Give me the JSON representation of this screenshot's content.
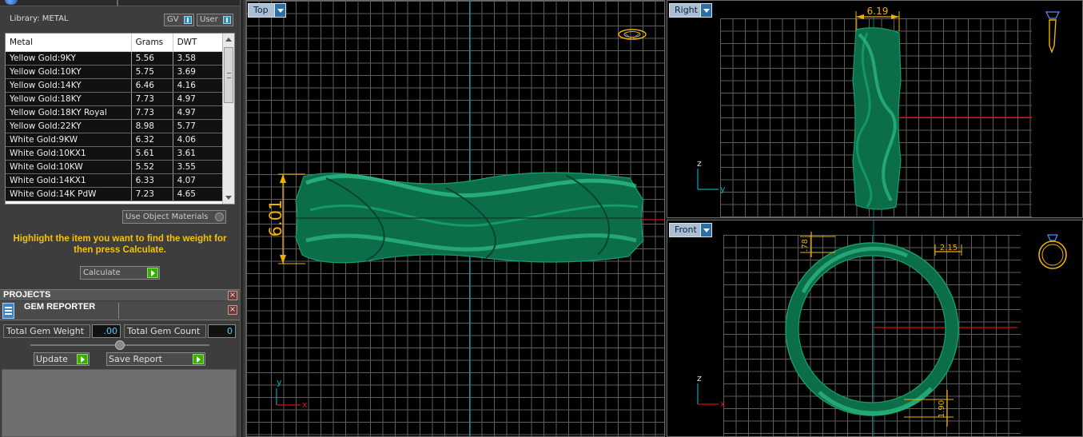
{
  "library": {
    "label": "Library: METAL",
    "gv_label": "GV",
    "user_label": "User"
  },
  "metal_table": {
    "columns": [
      "Metal",
      "Grams",
      "DWT"
    ],
    "rows": [
      [
        "Yellow Gold:9KY",
        "5.56",
        "3.58"
      ],
      [
        "Yellow Gold:10KY",
        "5.75",
        "3.69"
      ],
      [
        "Yellow Gold:14KY",
        "6.46",
        "4.16"
      ],
      [
        "Yellow Gold:18KY",
        "7.73",
        "4.97"
      ],
      [
        "Yellow Gold:18KY Royal",
        "7.73",
        "4.97"
      ],
      [
        "Yellow Gold:22KY",
        "8.98",
        "5.77"
      ],
      [
        "White Gold:9KW",
        "6.32",
        "4.06"
      ],
      [
        "White Gold:10KX1",
        "5.61",
        "3.61"
      ],
      [
        "White Gold:10KW",
        "5.52",
        "3.55"
      ],
      [
        "White Gold:14KX1",
        "6.33",
        "4.07"
      ],
      [
        "White Gold:14K PdW",
        "7.23",
        "4.65"
      ]
    ]
  },
  "use_object_materials_label": "Use Object Materials",
  "hint": "Highlight the item you want to find the weight for then press Calculate.",
  "calculate_label": "Calculate",
  "projects_title": "PROJECTS",
  "gem_reporter": {
    "title": "GEM REPORTER",
    "total_weight_label": "Total Gem Weight",
    "total_weight_value": ".00",
    "total_count_label": "Total Gem Count",
    "total_count_value": "0",
    "update_label": "Update",
    "save_report_label": "Save Report"
  },
  "viewports": {
    "top": {
      "label": "Top",
      "dimension": "6.01",
      "axis_v": "y",
      "axis_h": "x"
    },
    "right": {
      "label": "Right",
      "dimension": "6.19",
      "axis_v": "z",
      "axis_h": "y"
    },
    "front": {
      "label": "Front",
      "dim_a": ".78",
      "dim_b": "2.15",
      "dim_c": "1.90",
      "axis_v": "z",
      "axis_h": "x"
    }
  },
  "colors": {
    "ring_green": "#0f7a52",
    "dimension_yellow": "#f0b000",
    "axis_cyan": "#00b0c0",
    "axis_red": "#d01010",
    "hint_yellow": "#f5c400"
  }
}
